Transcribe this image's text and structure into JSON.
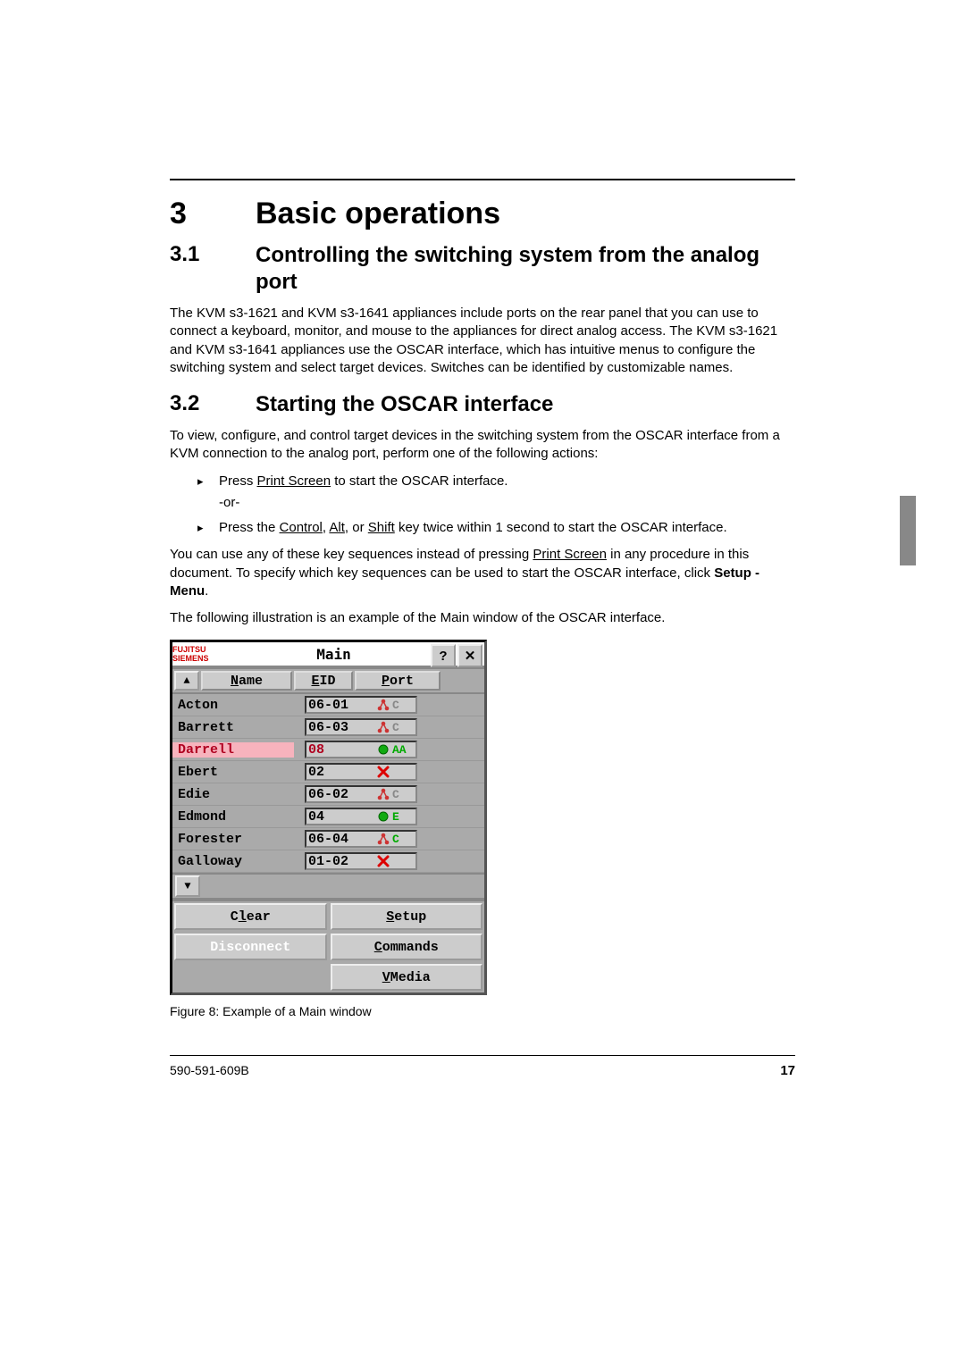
{
  "chapter": {
    "num": "3",
    "title": "Basic operations"
  },
  "s31": {
    "num": "3.1",
    "title": "Controlling the switching system from the analog port",
    "p1a": "The KVM s3-1621 and KVM s3-1641 appliances include ports on the rear panel that you can use to connect a keyboard, monitor, and mouse to the appliances for direct analog access. The KVM s3-1621 and KVM s3-1641 appliances use the OSCAR interface, which has intuitive menus to configure the switching system and select target devices. Switches can be identified by customizable names."
  },
  "s32": {
    "num": "3.2",
    "title": "Starting the OSCAR interface",
    "p1": "To view, configure, and control target devices in the switching system from the OSCAR interface from a KVM connection to the analog port, perform one of the following actions:",
    "li1a": "Press ",
    "li1b": "Print Screen",
    "li1c": " to start the OSCAR interface.",
    "li1or": "-or-",
    "li2a": "Press the ",
    "li2b": "Control",
    "li2c": ", ",
    "li2d": "Alt",
    "li2e": ", or ",
    "li2f": "Shift",
    "li2g": " key twice within 1 second to start the OSCAR interface.",
    "p2a": "You can use any of these key sequences instead of pressing ",
    "p2b": "Print Screen",
    "p2c": " in any procedure in this document. To specify which key sequences can be used to start the OSCAR interface, click ",
    "p2d": "Setup - Menu",
    "p2e": ".",
    "p3": "The following illustration is an example of the Main window of the OSCAR interface."
  },
  "oscar": {
    "logo": "FUJITSU SIEMENS",
    "title": "Main",
    "help": "?",
    "close": "✕",
    "sort_up": "▲",
    "sort_dn": "▼",
    "col_name": "Name",
    "col_name_u": "N",
    "col_name_rest": "ame",
    "col_eid": "EID",
    "col_eid_u": "E",
    "col_eid_rest": "ID",
    "col_port": "Port",
    "col_port_u": "P",
    "col_port_rest": "ort",
    "rows": [
      {
        "name": "Acton",
        "port": "06-01",
        "icon": "net",
        "tag": "C",
        "tagc": "grey",
        "sel": false
      },
      {
        "name": "Barrett",
        "port": "06-03",
        "icon": "net",
        "tag": "C",
        "tagc": "grey",
        "sel": false
      },
      {
        "name": "Darrell",
        "port": "08",
        "icon": "o",
        "tag": "AA",
        "tagc": "green",
        "sel": true
      },
      {
        "name": "Ebert",
        "port": "02",
        "icon": "x",
        "tag": "",
        "tagc": "",
        "sel": false
      },
      {
        "name": "Edie",
        "port": "06-02",
        "icon": "net",
        "tag": "C",
        "tagc": "grey",
        "sel": false
      },
      {
        "name": "Edmond",
        "port": "04",
        "icon": "o",
        "tag": "E",
        "tagc": "green",
        "sel": false
      },
      {
        "name": "Forester",
        "port": "06-04",
        "icon": "net",
        "tag": "C",
        "tagc": "green",
        "sel": false
      },
      {
        "name": "Galloway",
        "port": "01-02",
        "icon": "x",
        "tag": "",
        "tagc": "",
        "sel": false
      }
    ],
    "btn_clear_u": "l",
    "btn_clear": "C",
    "btn_clear_rest": "ear",
    "btn_setup_u": "S",
    "btn_setup_rest": "etup",
    "btn_disc": "Disconnect",
    "btn_cmd_u": "C",
    "btn_cmd_rest": "ommands",
    "btn_vm_u": "V",
    "btn_vm_rest": "Media"
  },
  "caption": "Figure 8: Example of a Main window",
  "footer": {
    "doc": "590-591-609B",
    "page": "17"
  }
}
